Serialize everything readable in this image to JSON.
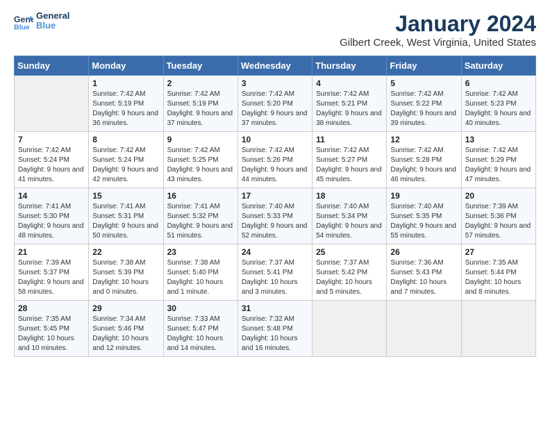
{
  "header": {
    "logo_line1": "General",
    "logo_line2": "Blue",
    "title": "January 2024",
    "subtitle": "Gilbert Creek, West Virginia, United States"
  },
  "days_of_week": [
    "Sunday",
    "Monday",
    "Tuesday",
    "Wednesday",
    "Thursday",
    "Friday",
    "Saturday"
  ],
  "weeks": [
    [
      {
        "day": "",
        "sunrise": "",
        "sunset": "",
        "daylight": "",
        "empty": true
      },
      {
        "day": "1",
        "sunrise": "Sunrise: 7:42 AM",
        "sunset": "Sunset: 5:19 PM",
        "daylight": "Daylight: 9 hours and 36 minutes.",
        "empty": false
      },
      {
        "day": "2",
        "sunrise": "Sunrise: 7:42 AM",
        "sunset": "Sunset: 5:19 PM",
        "daylight": "Daylight: 9 hours and 37 minutes.",
        "empty": false
      },
      {
        "day": "3",
        "sunrise": "Sunrise: 7:42 AM",
        "sunset": "Sunset: 5:20 PM",
        "daylight": "Daylight: 9 hours and 37 minutes.",
        "empty": false
      },
      {
        "day": "4",
        "sunrise": "Sunrise: 7:42 AM",
        "sunset": "Sunset: 5:21 PM",
        "daylight": "Daylight: 9 hours and 38 minutes.",
        "empty": false
      },
      {
        "day": "5",
        "sunrise": "Sunrise: 7:42 AM",
        "sunset": "Sunset: 5:22 PM",
        "daylight": "Daylight: 9 hours and 39 minutes.",
        "empty": false
      },
      {
        "day": "6",
        "sunrise": "Sunrise: 7:42 AM",
        "sunset": "Sunset: 5:23 PM",
        "daylight": "Daylight: 9 hours and 40 minutes.",
        "empty": false
      }
    ],
    [
      {
        "day": "7",
        "sunrise": "Sunrise: 7:42 AM",
        "sunset": "Sunset: 5:24 PM",
        "daylight": "Daylight: 9 hours and 41 minutes.",
        "empty": false
      },
      {
        "day": "8",
        "sunrise": "Sunrise: 7:42 AM",
        "sunset": "Sunset: 5:24 PM",
        "daylight": "Daylight: 9 hours and 42 minutes.",
        "empty": false
      },
      {
        "day": "9",
        "sunrise": "Sunrise: 7:42 AM",
        "sunset": "Sunset: 5:25 PM",
        "daylight": "Daylight: 9 hours and 43 minutes.",
        "empty": false
      },
      {
        "day": "10",
        "sunrise": "Sunrise: 7:42 AM",
        "sunset": "Sunset: 5:26 PM",
        "daylight": "Daylight: 9 hours and 44 minutes.",
        "empty": false
      },
      {
        "day": "11",
        "sunrise": "Sunrise: 7:42 AM",
        "sunset": "Sunset: 5:27 PM",
        "daylight": "Daylight: 9 hours and 45 minutes.",
        "empty": false
      },
      {
        "day": "12",
        "sunrise": "Sunrise: 7:42 AM",
        "sunset": "Sunset: 5:28 PM",
        "daylight": "Daylight: 9 hours and 46 minutes.",
        "empty": false
      },
      {
        "day": "13",
        "sunrise": "Sunrise: 7:42 AM",
        "sunset": "Sunset: 5:29 PM",
        "daylight": "Daylight: 9 hours and 47 minutes.",
        "empty": false
      }
    ],
    [
      {
        "day": "14",
        "sunrise": "Sunrise: 7:41 AM",
        "sunset": "Sunset: 5:30 PM",
        "daylight": "Daylight: 9 hours and 48 minutes.",
        "empty": false
      },
      {
        "day": "15",
        "sunrise": "Sunrise: 7:41 AM",
        "sunset": "Sunset: 5:31 PM",
        "daylight": "Daylight: 9 hours and 50 minutes.",
        "empty": false
      },
      {
        "day": "16",
        "sunrise": "Sunrise: 7:41 AM",
        "sunset": "Sunset: 5:32 PM",
        "daylight": "Daylight: 9 hours and 51 minutes.",
        "empty": false
      },
      {
        "day": "17",
        "sunrise": "Sunrise: 7:40 AM",
        "sunset": "Sunset: 5:33 PM",
        "daylight": "Daylight: 9 hours and 52 minutes.",
        "empty": false
      },
      {
        "day": "18",
        "sunrise": "Sunrise: 7:40 AM",
        "sunset": "Sunset: 5:34 PM",
        "daylight": "Daylight: 9 hours and 54 minutes.",
        "empty": false
      },
      {
        "day": "19",
        "sunrise": "Sunrise: 7:40 AM",
        "sunset": "Sunset: 5:35 PM",
        "daylight": "Daylight: 9 hours and 55 minutes.",
        "empty": false
      },
      {
        "day": "20",
        "sunrise": "Sunrise: 7:39 AM",
        "sunset": "Sunset: 5:36 PM",
        "daylight": "Daylight: 9 hours and 57 minutes.",
        "empty": false
      }
    ],
    [
      {
        "day": "21",
        "sunrise": "Sunrise: 7:39 AM",
        "sunset": "Sunset: 5:37 PM",
        "daylight": "Daylight: 9 hours and 58 minutes.",
        "empty": false
      },
      {
        "day": "22",
        "sunrise": "Sunrise: 7:38 AM",
        "sunset": "Sunset: 5:39 PM",
        "daylight": "Daylight: 10 hours and 0 minutes.",
        "empty": false
      },
      {
        "day": "23",
        "sunrise": "Sunrise: 7:38 AM",
        "sunset": "Sunset: 5:40 PM",
        "daylight": "Daylight: 10 hours and 1 minute.",
        "empty": false
      },
      {
        "day": "24",
        "sunrise": "Sunrise: 7:37 AM",
        "sunset": "Sunset: 5:41 PM",
        "daylight": "Daylight: 10 hours and 3 minutes.",
        "empty": false
      },
      {
        "day": "25",
        "sunrise": "Sunrise: 7:37 AM",
        "sunset": "Sunset: 5:42 PM",
        "daylight": "Daylight: 10 hours and 5 minutes.",
        "empty": false
      },
      {
        "day": "26",
        "sunrise": "Sunrise: 7:36 AM",
        "sunset": "Sunset: 5:43 PM",
        "daylight": "Daylight: 10 hours and 7 minutes.",
        "empty": false
      },
      {
        "day": "27",
        "sunrise": "Sunrise: 7:35 AM",
        "sunset": "Sunset: 5:44 PM",
        "daylight": "Daylight: 10 hours and 8 minutes.",
        "empty": false
      }
    ],
    [
      {
        "day": "28",
        "sunrise": "Sunrise: 7:35 AM",
        "sunset": "Sunset: 5:45 PM",
        "daylight": "Daylight: 10 hours and 10 minutes.",
        "empty": false
      },
      {
        "day": "29",
        "sunrise": "Sunrise: 7:34 AM",
        "sunset": "Sunset: 5:46 PM",
        "daylight": "Daylight: 10 hours and 12 minutes.",
        "empty": false
      },
      {
        "day": "30",
        "sunrise": "Sunrise: 7:33 AM",
        "sunset": "Sunset: 5:47 PM",
        "daylight": "Daylight: 10 hours and 14 minutes.",
        "empty": false
      },
      {
        "day": "31",
        "sunrise": "Sunrise: 7:32 AM",
        "sunset": "Sunset: 5:48 PM",
        "daylight": "Daylight: 10 hours and 16 minutes.",
        "empty": false
      },
      {
        "day": "",
        "sunrise": "",
        "sunset": "",
        "daylight": "",
        "empty": true
      },
      {
        "day": "",
        "sunrise": "",
        "sunset": "",
        "daylight": "",
        "empty": true
      },
      {
        "day": "",
        "sunrise": "",
        "sunset": "",
        "daylight": "",
        "empty": true
      }
    ]
  ]
}
